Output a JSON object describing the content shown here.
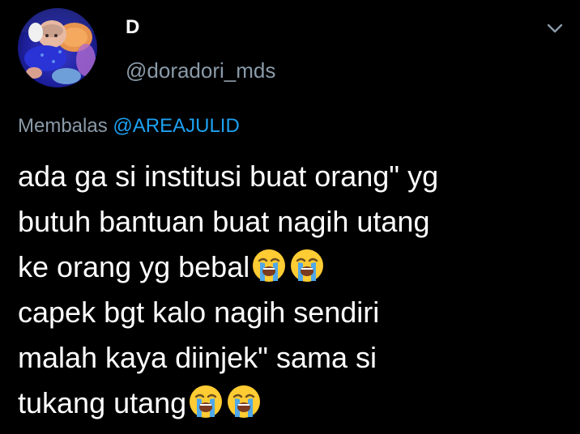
{
  "author": {
    "display_name": "D",
    "handle": "@doradori_mds",
    "avatar_icon": "avatar-photo"
  },
  "menu": {
    "icon": "chevron-down-icon"
  },
  "reply": {
    "prefix": "Membalas",
    "mention": "@AREAJULID",
    "mention_color": "#1da1f2"
  },
  "tweet": {
    "lines": [
      "ada ga si institusi buat orang\" yg",
      "butuh bantuan buat nagih utang",
      "ke orang yg bebal",
      "capek bgt kalo nagih sendiri",
      "malah kaya diinjek\" sama si",
      "tukang utang"
    ],
    "emoji_icon": "loudly-crying-face-emoji"
  },
  "colors": {
    "background": "#000000",
    "text": "#ffffff",
    "secondary": "#8a9aa8",
    "accent": "#1da1f2"
  }
}
